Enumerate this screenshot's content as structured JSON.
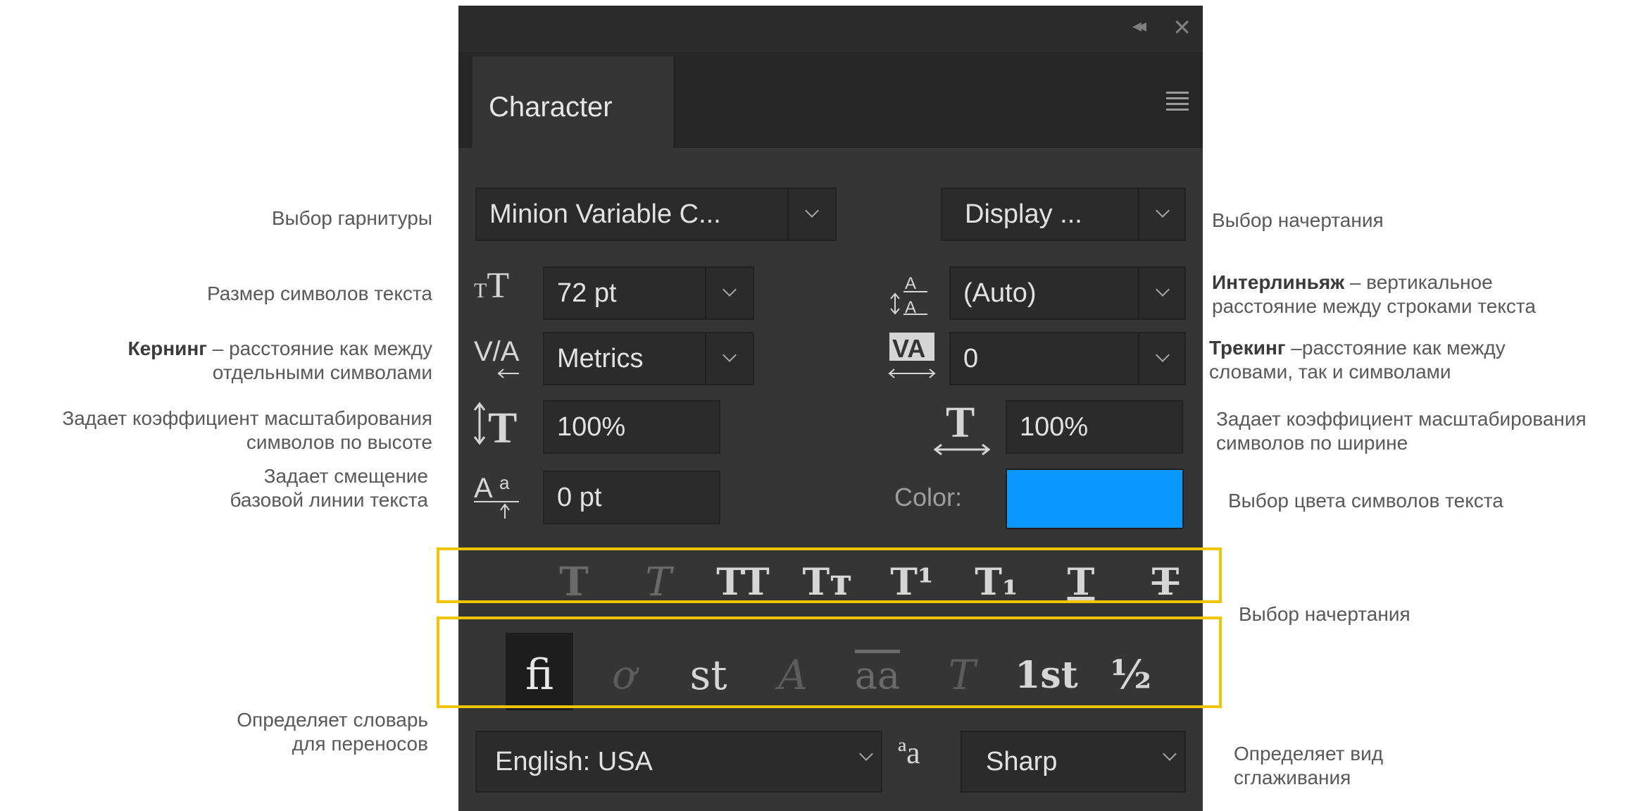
{
  "panel": {
    "tab_title": "Character",
    "collapse_icon": "◂◂",
    "close_icon": "✕",
    "font_family": "Minion Variable C...",
    "font_style": "Display ...",
    "font_size": "72 pt",
    "leading": "(Auto)",
    "kerning": "Metrics",
    "tracking": "0",
    "vertical_scale": "100%",
    "horizontal_scale": "100%",
    "baseline_shift": "0 pt",
    "color_label": "Color:",
    "color_value": "#0898ff",
    "language": "English: USA",
    "antialias": "Sharp",
    "aa_icon": "ªa",
    "style_buttons": [
      "T",
      "T",
      "TT",
      "Tт",
      "T¹",
      "T₁",
      "T",
      "T"
    ],
    "opentype_buttons": [
      "fi",
      "ơ",
      "st",
      "A",
      "aa",
      "T",
      "1st",
      "½"
    ]
  },
  "annotations": {
    "font_family": "Выбор гарнитуры",
    "font_style": "Выбор начертания",
    "font_size": "Размер символов текста",
    "leading_bold": "Интерлиньяж",
    "leading_rest": " – вертикальное",
    "leading_line2": "расстояние между строками текста",
    "kerning_bold": "Кернинг",
    "kerning_rest": " – расстояние как между",
    "kerning_line2": "отдельными символами",
    "tracking_bold": "Трекинг",
    "tracking_rest": " –расстояние как между",
    "tracking_line2": "словами, так и символами",
    "vscale_line1": "Задает коэффициент масштабирования",
    "vscale_line2": "символов по высоте",
    "hscale_line1": "Задает коэффициент масштабирования",
    "hscale_line2": "символов по ширине",
    "baseline_line1": "Задает смещение",
    "baseline_line2": "базовой линии текста",
    "color": "Выбор цвета символов текста",
    "style_buttons": "Выбор начертания",
    "hyphenation_line1": "Определяет словарь",
    "hyphenation_line2": "для переносов",
    "antialias_line1": "Определяет вид",
    "antialias_line2": "сглаживания"
  }
}
